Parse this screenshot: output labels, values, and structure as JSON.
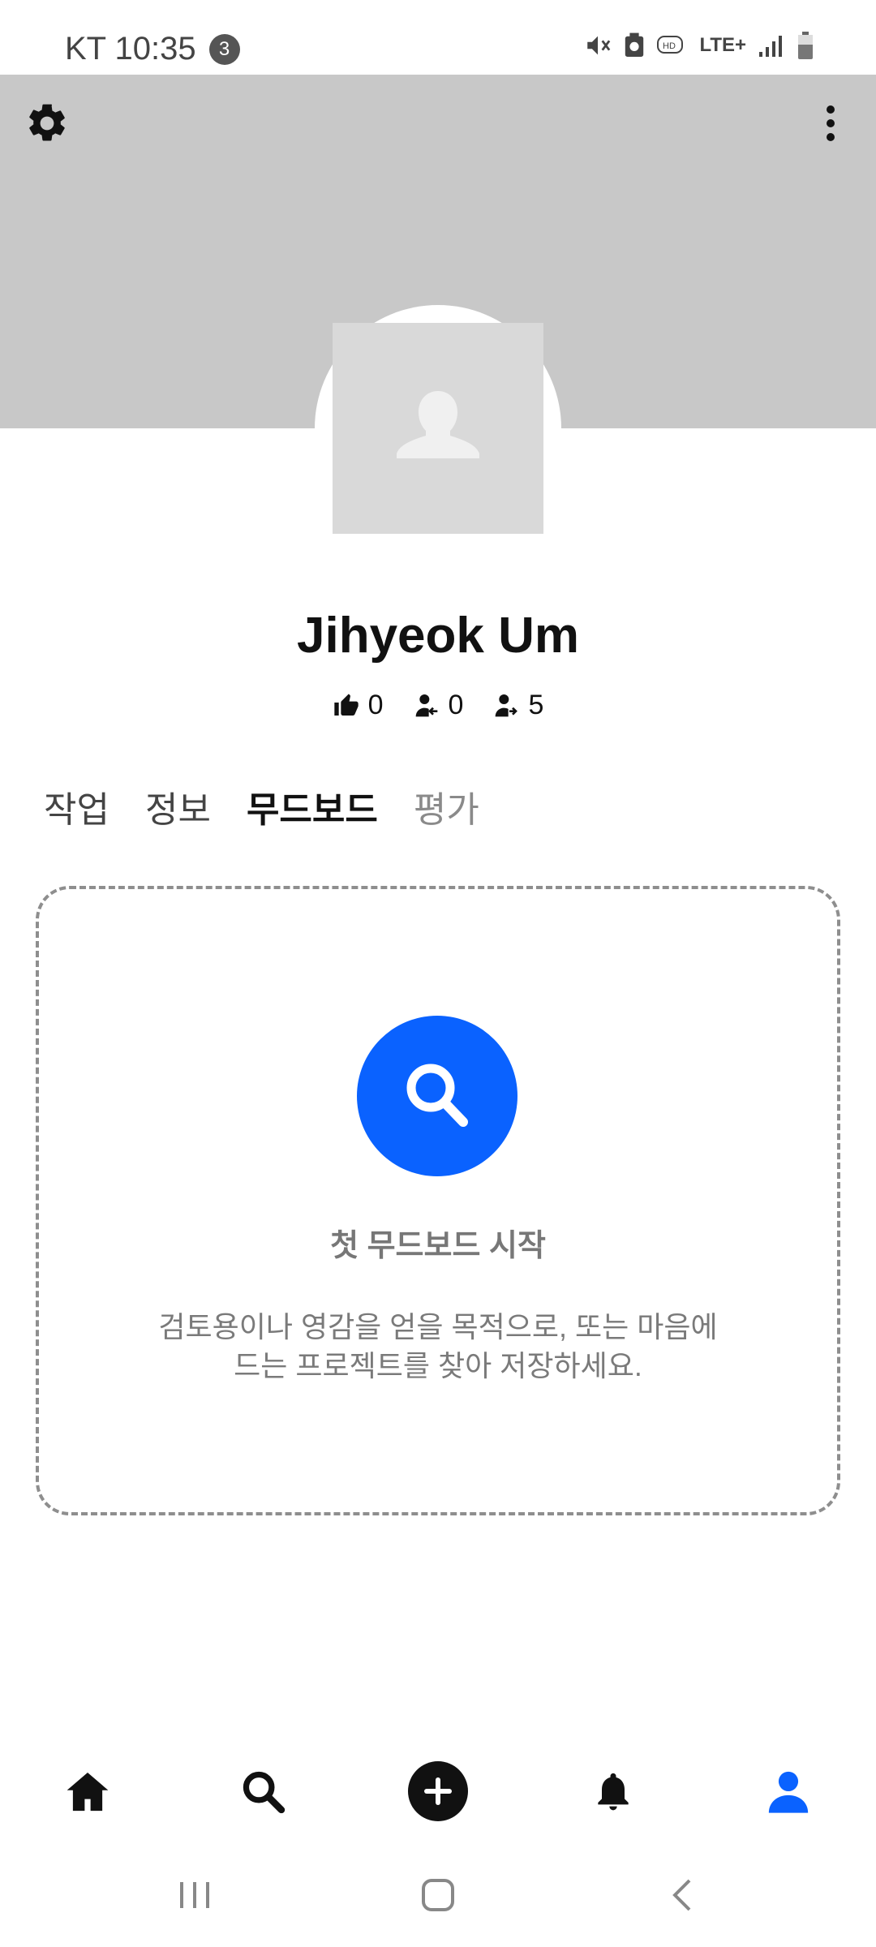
{
  "status_bar": {
    "carrier_time": "KT 10:35",
    "notification_count": "3",
    "network": "LTE+"
  },
  "profile": {
    "name": "Jihyeok Um",
    "likes": "0",
    "followers": "0",
    "following": "5"
  },
  "tabs": [
    {
      "label": "작업",
      "state": "normal"
    },
    {
      "label": "정보",
      "state": "normal"
    },
    {
      "label": "무드보드",
      "state": "active"
    },
    {
      "label": "평가",
      "state": "dim"
    }
  ],
  "empty_state": {
    "title": "첫 무드보드 시작",
    "line1": "검토용이나 영감을 얻을 목적으로, 또는 마음에",
    "line2": "드는 프로젝트를 찾아 저장하세요."
  },
  "colors": {
    "accent": "#0a62ff",
    "cover": "#c8c8c8",
    "avatar_placeholder": "#d9d9d9"
  },
  "icons": {
    "settings": "gear-icon",
    "more": "more-vertical-icon",
    "like": "thumbs-up-icon",
    "followers": "followers-icon",
    "following": "following-icon",
    "search": "search-icon",
    "home": "home-icon",
    "add": "add-circle-icon",
    "notifications": "bell-icon",
    "profile": "profile-icon"
  }
}
